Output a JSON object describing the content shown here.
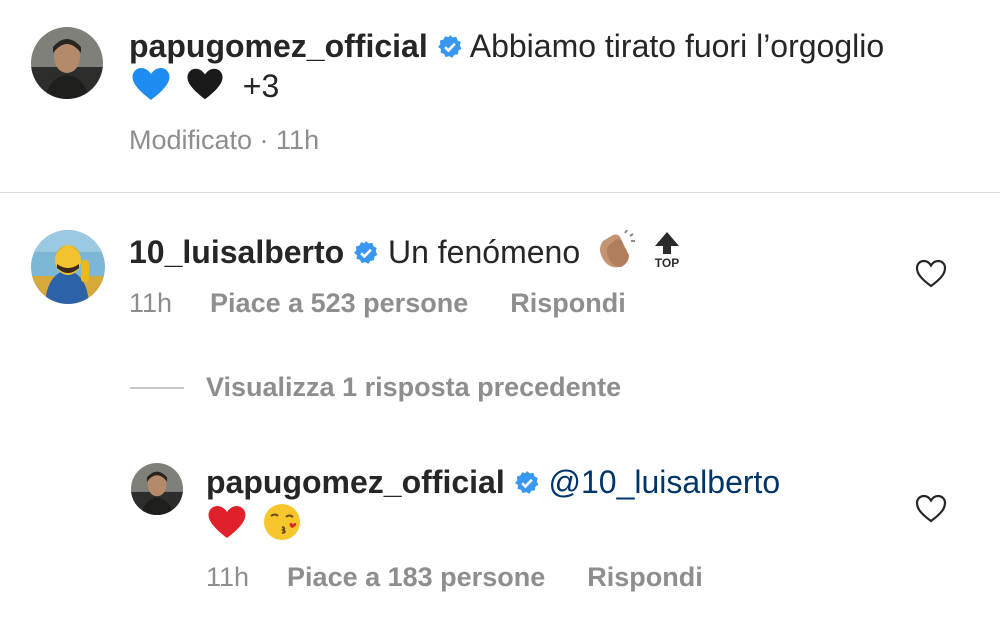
{
  "caption": {
    "username": "papugomez_official",
    "text": "Abbiamo tirato fuori l’orgoglio",
    "extra": "+3",
    "meta": "Modificato · 11h",
    "emojis": [
      "blue-heart",
      "black-heart"
    ]
  },
  "comment1": {
    "username": "10_luisalberto",
    "text": "Un fenómeno",
    "emojis": [
      "clapping-hands",
      "top-arrow"
    ],
    "time": "11h",
    "likes": "Piace a 523 persone",
    "reply_label": "Rispondi"
  },
  "view_replies": {
    "label": "Visualizza 1 risposta precedente"
  },
  "reply1": {
    "username": "papugomez_official",
    "mention": "@10_luisalberto",
    "emojis": [
      "red-heart",
      "kissing-face"
    ],
    "time": "11h",
    "likes": "Piace a 183 persone",
    "reply_label": "Rispondi"
  },
  "colors": {
    "verified": "#3897f0",
    "mention": "#003569",
    "meta_text": "#8e8e8e",
    "divider": "#dbdbdb"
  }
}
